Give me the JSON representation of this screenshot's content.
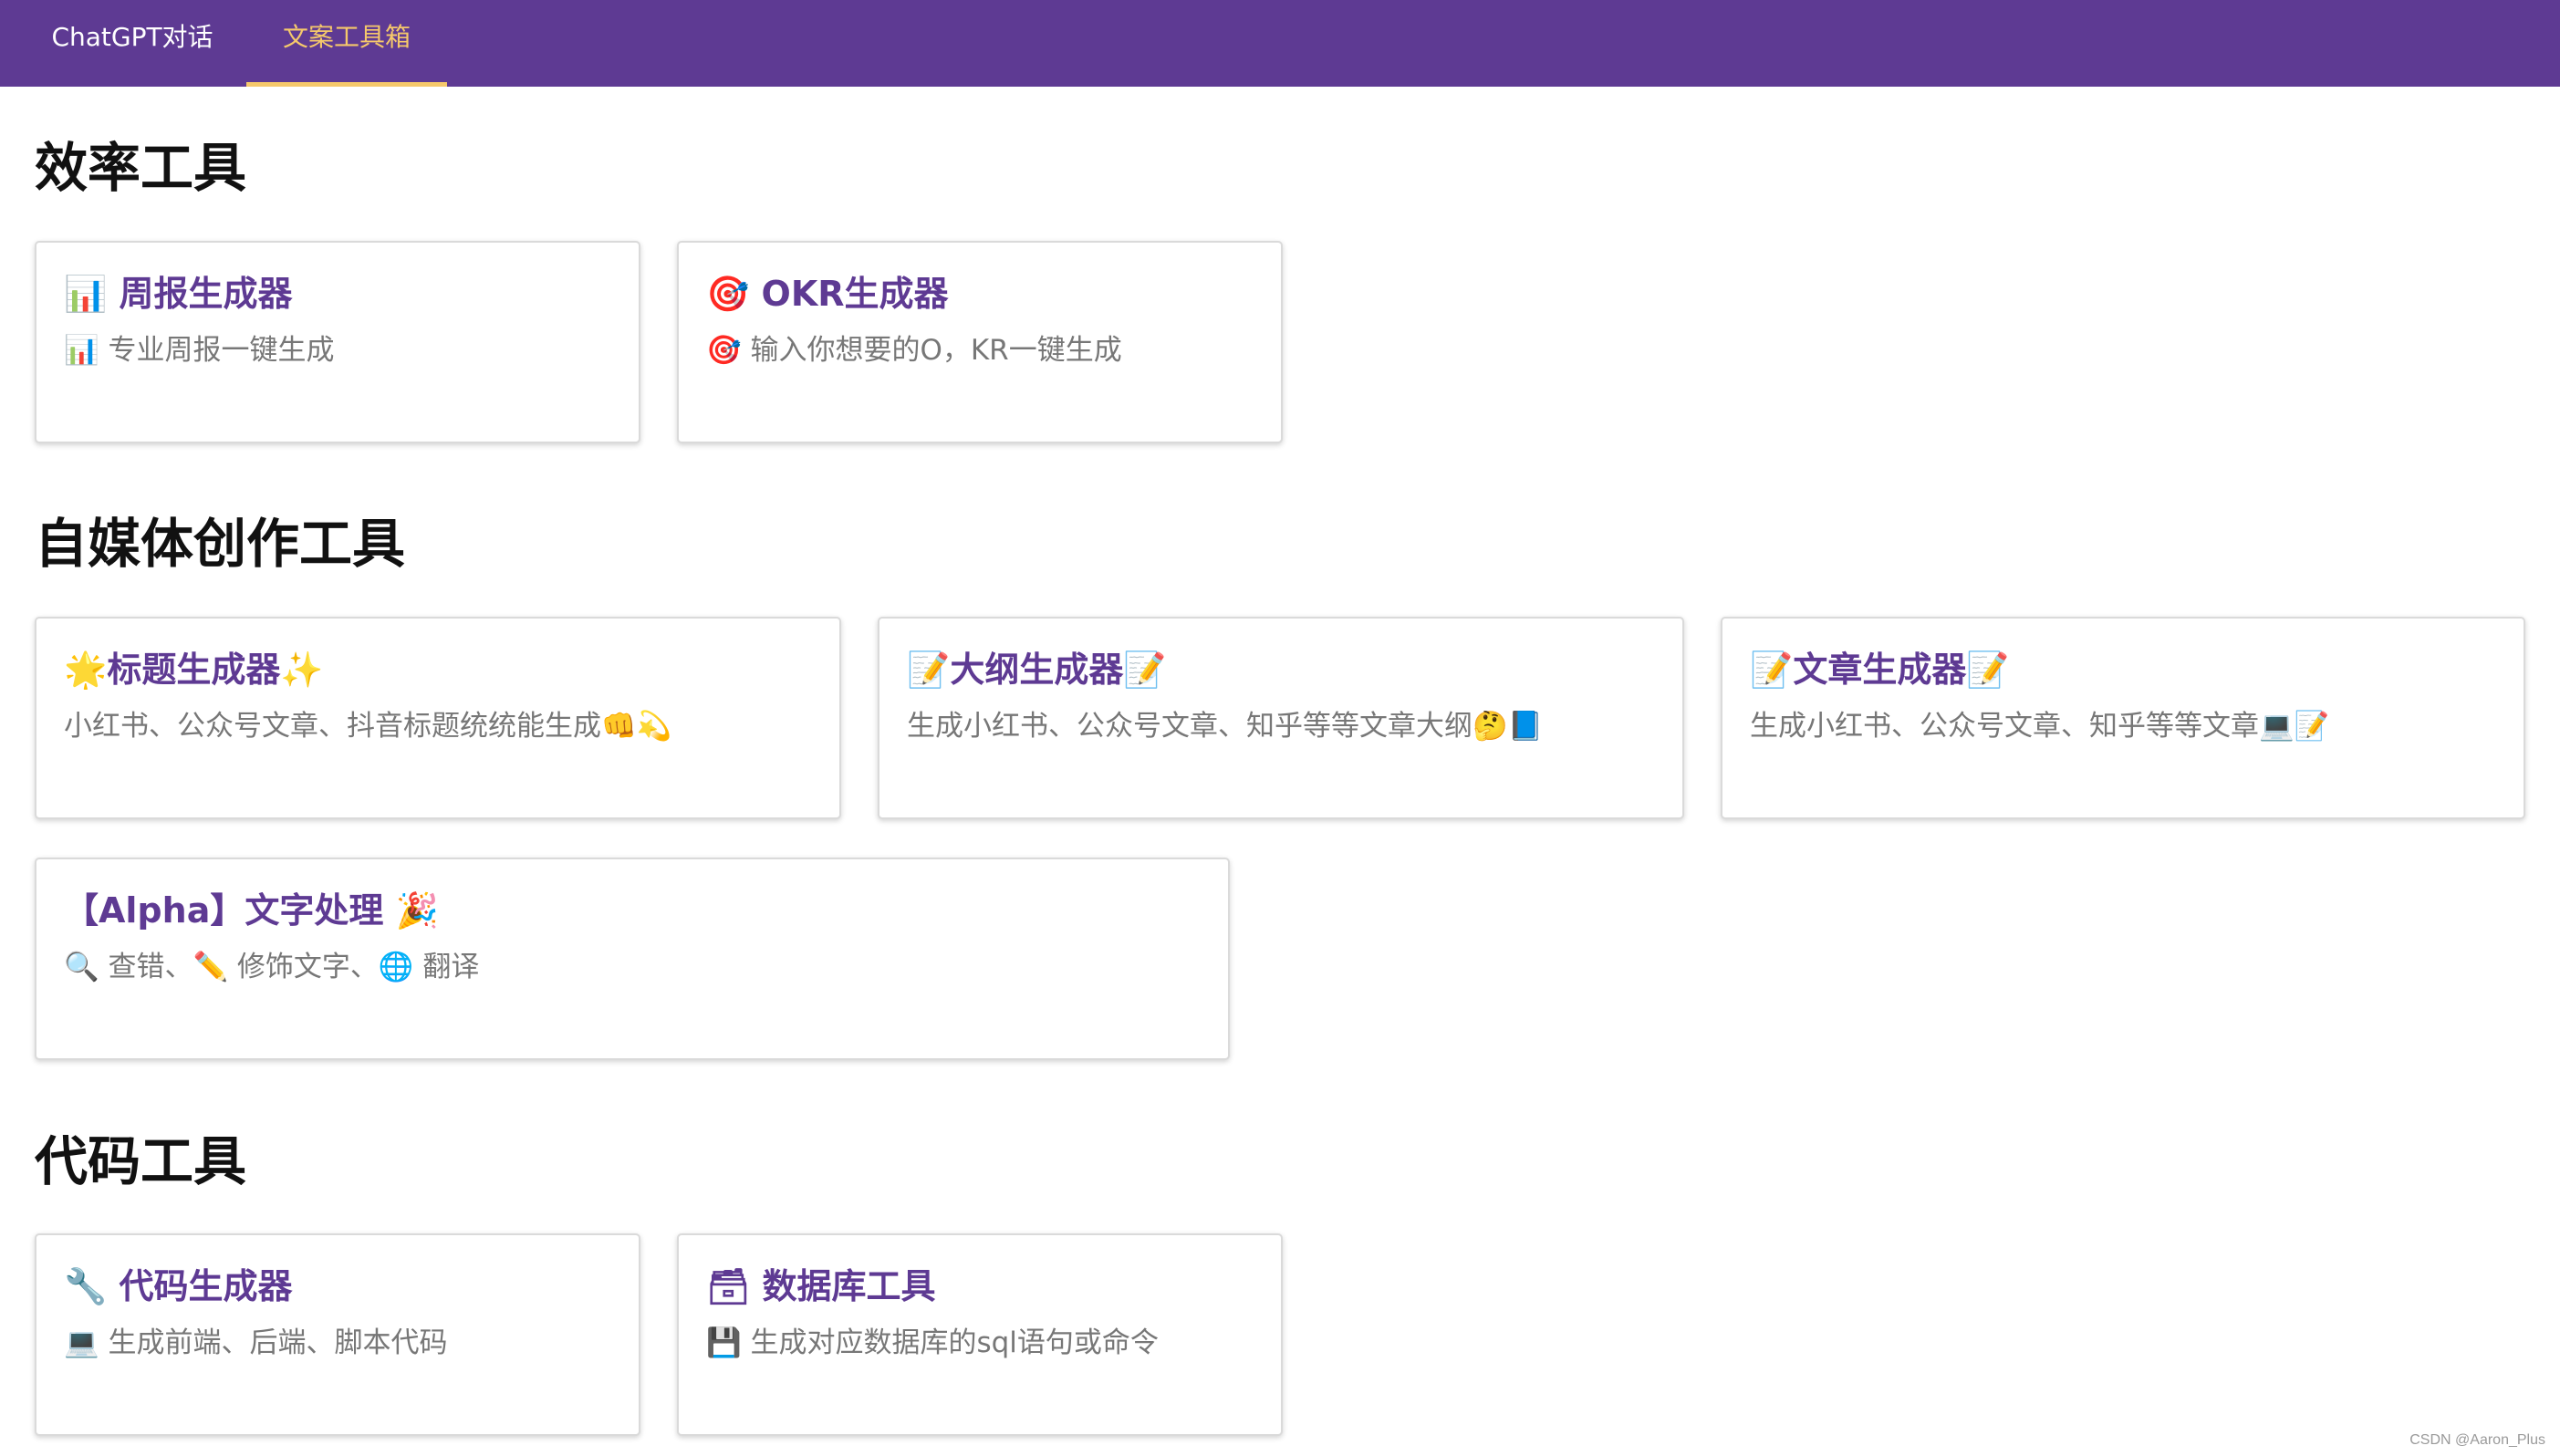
{
  "nav": {
    "tabs": [
      {
        "label": "ChatGPT对话",
        "active": false
      },
      {
        "label": "文案工具箱",
        "active": true
      }
    ]
  },
  "sections": [
    {
      "title": "效率工具",
      "cards": [
        {
          "title": "📊 周报生成器",
          "desc": "📊 专业周报一键生成"
        },
        {
          "title": "🎯 OKR生成器",
          "desc": "🎯 输入你想要的O，KR一键生成"
        }
      ]
    },
    {
      "title": "自媒体创作工具",
      "cards": [
        {
          "title": "🌟标题生成器✨",
          "desc": "小红书、公众号文章、抖音标题统统能生成👊💫"
        },
        {
          "title": "📝大纲生成器📝",
          "desc": "生成小红书、公众号文章、知乎等等文章大纲🤔📘"
        },
        {
          "title": "📝文章生成器📝",
          "desc": "生成小红书、公众号文章、知乎等等文章💻📝"
        },
        {
          "title": "【Alpha】文字处理 🎉",
          "desc": "🔍 查错、✏️ 修饰文字、🌐 翻译"
        }
      ]
    },
    {
      "title": "代码工具",
      "cards": [
        {
          "title": "🔧 代码生成器",
          "desc": "💻 生成前端、后端、脚本代码"
        },
        {
          "title": "🗃 数据库工具",
          "desc": "💾 生成对应数据库的sql语句或命令"
        }
      ]
    }
  ],
  "footer": {
    "credit": "CSDN @Aaron_Plus"
  },
  "colors": {
    "topbar": "#5e3a93",
    "active_tab": "#f5c86b",
    "card_title": "#5e3a93",
    "card_desc": "#777777"
  }
}
